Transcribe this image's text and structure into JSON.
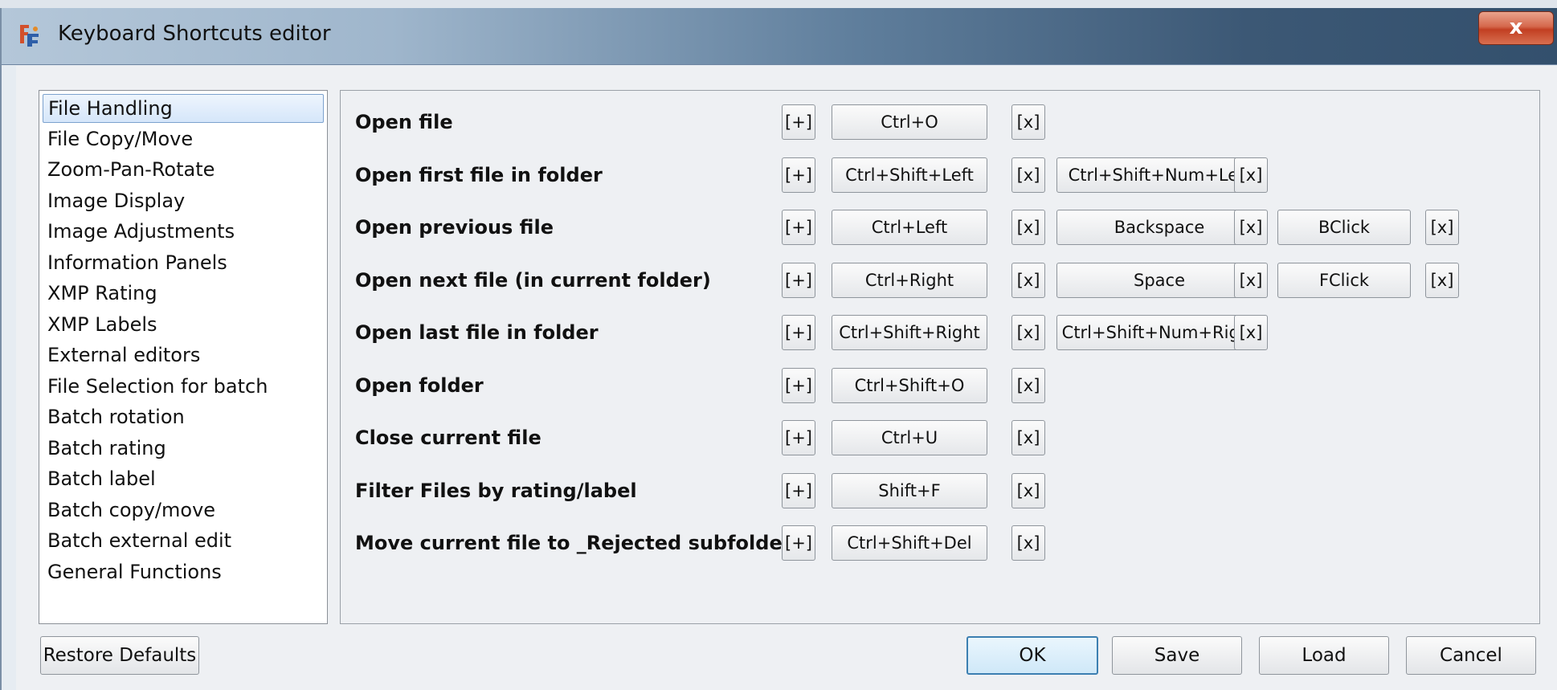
{
  "window": {
    "title": "Keyboard Shortcuts editor",
    "close_label": "x"
  },
  "categories": [
    "File Handling",
    "File Copy/Move",
    "Zoom-Pan-Rotate",
    "Image Display",
    "Image Adjustments",
    "Information Panels",
    "XMP Rating",
    "XMP Labels",
    "External editors",
    "File Selection for batch",
    "Batch rotation",
    "Batch rating",
    "Batch label",
    "Batch copy/move",
    "Batch external edit",
    "General Functions"
  ],
  "selected_category": "File Handling",
  "shortcuts": [
    {
      "label": "Open file",
      "add": "[+]",
      "keys": [
        "Ctrl+O"
      ],
      "remove": "[x]"
    },
    {
      "label": "Open first file in folder",
      "add": "[+]",
      "keys": [
        "Ctrl+Shift+Left",
        "Ctrl+Shift+Num+Left"
      ],
      "remove": "[x]"
    },
    {
      "label": "Open previous file",
      "add": "[+]",
      "keys": [
        "Ctrl+Left",
        "Backspace",
        "BClick"
      ],
      "remove": "[x]"
    },
    {
      "label": "Open next file (in current folder)",
      "add": "[+]",
      "keys": [
        "Ctrl+Right",
        "Space",
        "FClick"
      ],
      "remove": "[x]"
    },
    {
      "label": "Open last file in folder",
      "add": "[+]",
      "keys": [
        "Ctrl+Shift+Right",
        "Ctrl+Shift+Num+Right"
      ],
      "remove": "[x]"
    },
    {
      "label": "Open folder",
      "add": "[+]",
      "keys": [
        "Ctrl+Shift+O"
      ],
      "remove": "[x]"
    },
    {
      "label": "Close current file",
      "add": "[+]",
      "keys": [
        "Ctrl+U"
      ],
      "remove": "[x]"
    },
    {
      "label": "Filter Files by rating/label",
      "add": "[+]",
      "keys": [
        "Shift+F"
      ],
      "remove": "[x]"
    },
    {
      "label": "Move current file to _Rejected subfolder",
      "add": "[+]",
      "keys": [
        "Ctrl+Shift+Del"
      ],
      "remove": "[x]"
    }
  ],
  "buttons": {
    "restore_defaults": "Restore Defaults",
    "ok": "OK",
    "save": "Save",
    "load": "Load",
    "cancel": "Cancel"
  },
  "icons": {
    "app": "app-logo-icon",
    "close": "close-icon"
  }
}
